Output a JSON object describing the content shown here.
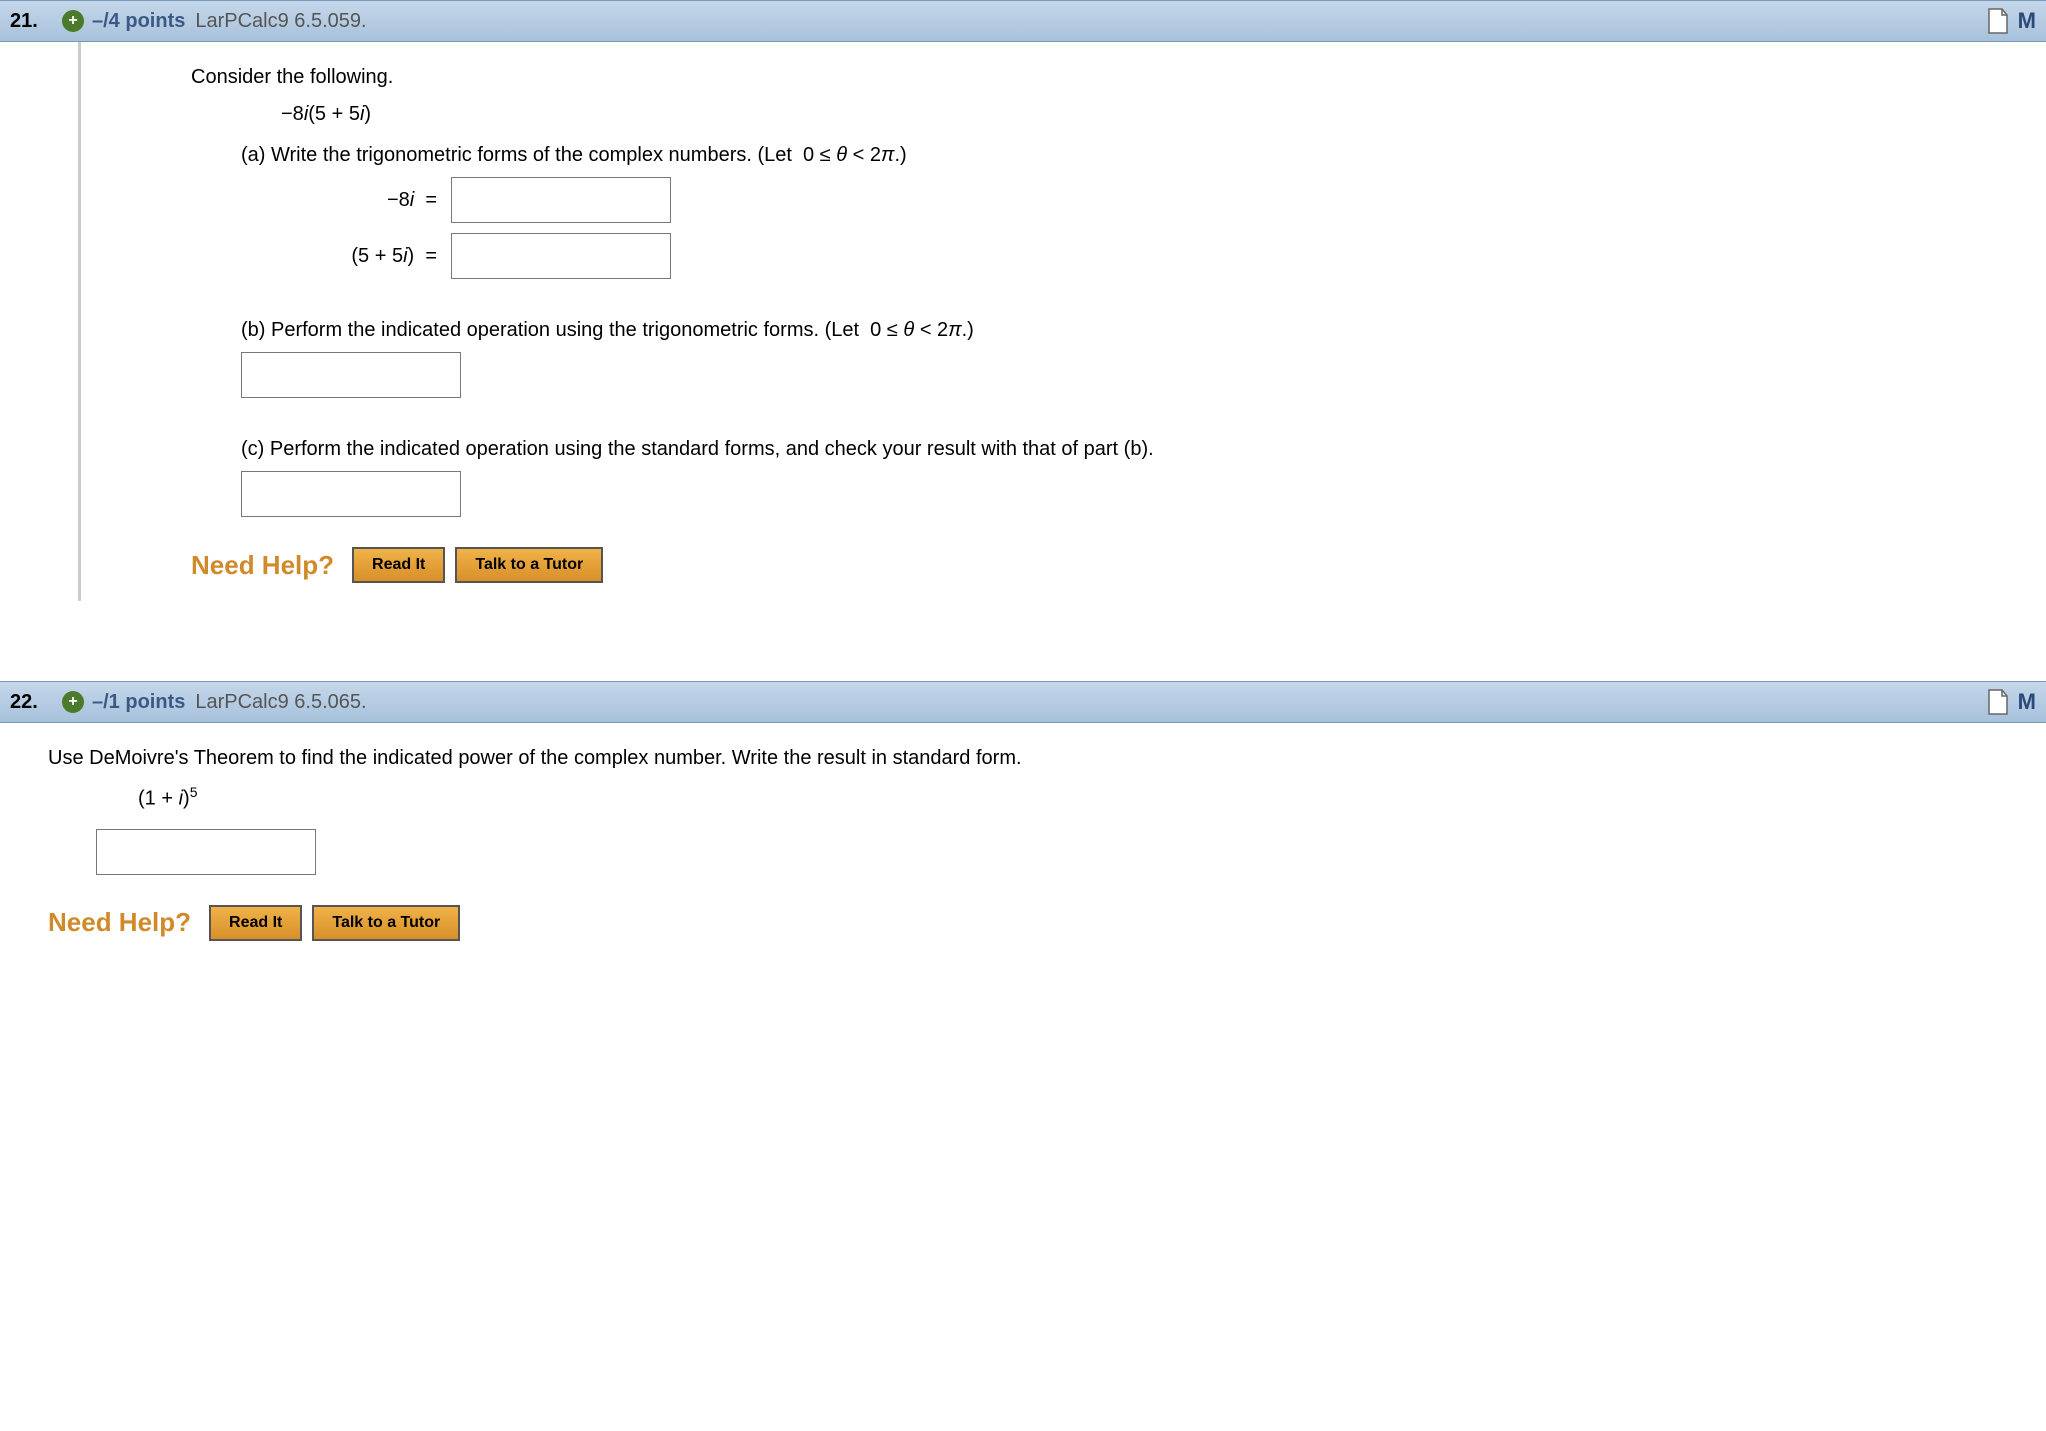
{
  "questions": [
    {
      "number": "21.",
      "points": "–/4 points",
      "source": "LarPCalc9 6.5.059.",
      "prompt": "Consider the following.",
      "expression": "−8i(5 + 5i)",
      "parts": {
        "a": {
          "text": "(a) Write the trigonometric forms of the complex numbers. (Let  0 ≤ θ < 2π.)",
          "inputs": [
            {
              "label": "−8i  ="
            },
            {
              "label": "(5 + 5i)  ="
            }
          ]
        },
        "b": {
          "text": "(b) Perform the indicated operation using the trigonometric forms. (Let  0 ≤ θ < 2π.)"
        },
        "c": {
          "text": "(c) Perform the indicated operation using the standard forms, and check your result with that of part (b)."
        }
      }
    },
    {
      "number": "22.",
      "points": "–/1 points",
      "source": "LarPCalc9 6.5.065.",
      "prompt": "Use DeMoivre's Theorem to find the indicated power of the complex number. Write the result in standard form.",
      "expression_base": "(1 + i)",
      "expression_exp": "5"
    }
  ],
  "help": {
    "label": "Need Help?",
    "read": "Read It",
    "tutor": "Talk to a Tutor"
  },
  "header_right": "M"
}
